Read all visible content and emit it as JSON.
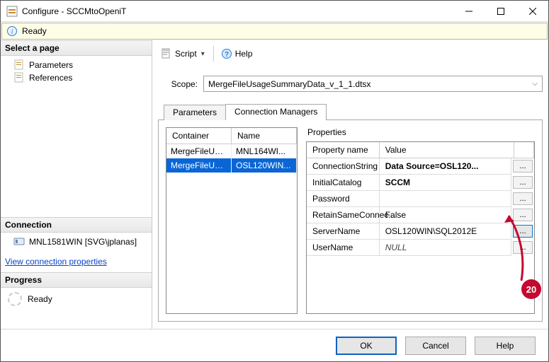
{
  "window": {
    "title": "Configure - SCCMtoOpeniT",
    "ready": "Ready"
  },
  "left": {
    "select_page": "Select a page",
    "params": "Parameters",
    "refs": "References",
    "connection_hdr": "Connection",
    "connection_val": "MNL1581WIN [SVG\\jplanas]",
    "view_link": "View connection properties",
    "progress_hdr": "Progress",
    "progress_val": "Ready"
  },
  "toolbar": {
    "script": "Script",
    "help": "Help"
  },
  "scope": {
    "label": "Scope:",
    "value": "MergeFileUsageSummaryData_v_1_1.dtsx"
  },
  "tabs": {
    "params": "Parameters",
    "conn": "Connection Managers"
  },
  "left_grid": {
    "h1": "Container",
    "h2": "Name",
    "r0c0": "MergeFileUsag...",
    "r0c1": "MNL164WI...",
    "r1c0": "MergeFileUsag...",
    "r1c1": "OSL120WIN..."
  },
  "props": {
    "title": "Properties",
    "h1": "Property name",
    "h2": "Value",
    "rows": {
      "r0": {
        "n": "ConnectionString",
        "v": "Data Source=OSL120...",
        "bold": true
      },
      "r1": {
        "n": "InitialCatalog",
        "v": "SCCM",
        "bold": true
      },
      "r2": {
        "n": "Password",
        "v": ""
      },
      "r3": {
        "n": "RetainSameConnec...",
        "v": "False"
      },
      "r4": {
        "n": "ServerName",
        "v": "OSL120WIN\\SQL2012E"
      },
      "r5": {
        "n": "UserName",
        "v": "NULL",
        "null": true
      }
    },
    "btn": "..."
  },
  "buttons": {
    "ok": "OK",
    "cancel": "Cancel",
    "help": "Help"
  },
  "annotation": {
    "num": "20"
  }
}
